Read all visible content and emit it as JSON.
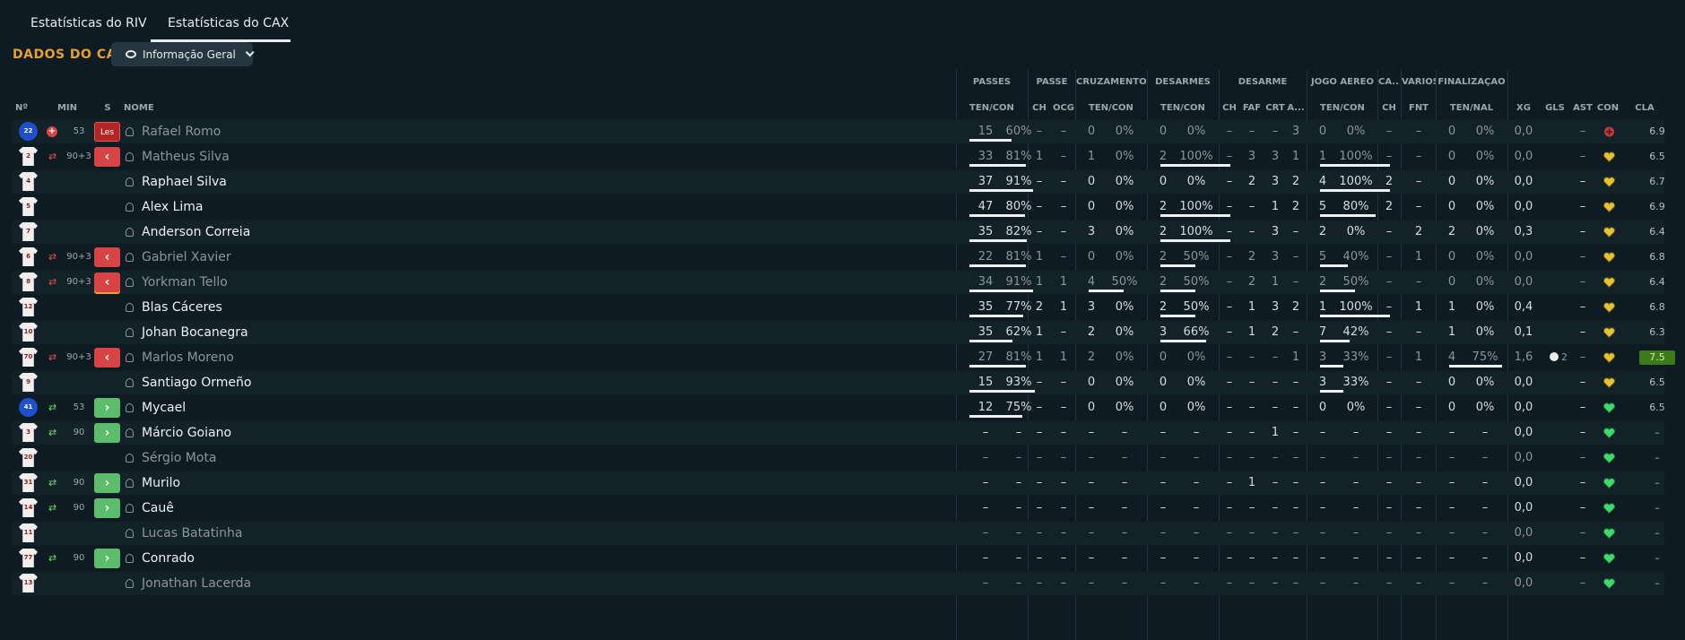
{
  "tabs": [
    {
      "label": "Estatísticas do RIV"
    },
    {
      "label": "Estatísticas do CAX"
    }
  ],
  "heading": "DADOS DO CAX",
  "dropdown": {
    "label": "Informação Geral"
  },
  "groups": {
    "passes": "PASSES",
    "passe": "PASSE",
    "cruzamentos": "CRUZAMENTOS",
    "desarmes": "DESARMES",
    "desarme": "DESARME",
    "jogo_aereo": "JOGO AÉREO",
    "ca": "CA...",
    "varios": "VÁRIOS",
    "finalizacao": "FINALIZAÇÃO"
  },
  "headers": {
    "n": "Nº",
    "min": "MIN",
    "s": "S",
    "nome": "NOME",
    "passes_tc": "TEN/CON",
    "passe_ch": "CH",
    "passe_ocg": "OCG",
    "cruz_tc": "TEN/CON",
    "des_tc": "TEN/CON",
    "d_ch": "CH",
    "d_faf": "FAF",
    "d_crt": "CRT",
    "d_a": "A...",
    "ja_tc": "TEN/CON",
    "ca_ch": "CH",
    "v_fnt": "FNT",
    "fin_tn": "TEN/NAL",
    "xg": "XG",
    "gls": "GLS",
    "ast": "AST",
    "con": "CON",
    "cla": "CLA"
  },
  "rows": [
    {
      "num": "22",
      "kit": "blue",
      "icon": "injury",
      "min": "53",
      "s": "Les",
      "sk": "les",
      "name": "Rafael Romo",
      "dim": true,
      "p1": "15",
      "p2": "60%",
      "pch": "–",
      "pocg": "–",
      "cr1": "0",
      "cr2": "0%",
      "de1": "0",
      "de2": "0%",
      "dch": "–",
      "dfaf": "–",
      "dcrt": "–",
      "da": "3",
      "ja1": "0",
      "ja2": "0%",
      "cach": "–",
      "vfnt": "–",
      "fi1": "0",
      "fi2": "0%",
      "xg": "0,0",
      "gls": "",
      "ast": "–",
      "con": "red",
      "cla": "6.9",
      "bars": {
        "p": 0.6
      }
    },
    {
      "num": "2",
      "kit": "white",
      "icon": "out",
      "min": "90+3",
      "s": "‹",
      "sk": "out",
      "name": "Matheus Silva",
      "dim": true,
      "p1": "33",
      "p2": "81%",
      "pch": "1",
      "pocg": "–",
      "cr1": "1",
      "cr2": "0%",
      "de1": "2",
      "de2": "100%",
      "dch": "–",
      "dfaf": "3",
      "dcrt": "3",
      "da": "1",
      "ja1": "1",
      "ja2": "100%",
      "cach": "–",
      "vfnt": "–",
      "fi1": "0",
      "fi2": "0%",
      "xg": "0,0",
      "gls": "",
      "ast": "–",
      "con": "yellow",
      "cla": "6.5",
      "bars": {
        "p": 0.81,
        "de": 1,
        "ja": 1
      }
    },
    {
      "num": "4",
      "kit": "white",
      "icon": "",
      "min": "",
      "s": "",
      "sk": "",
      "name": "Raphael Silva",
      "dim": false,
      "p1": "37",
      "p2": "91%",
      "pch": "–",
      "pocg": "–",
      "cr1": "0",
      "cr2": "0%",
      "de1": "0",
      "de2": "0%",
      "dch": "–",
      "dfaf": "2",
      "dcrt": "3",
      "da": "2",
      "ja1": "4",
      "ja2": "100%",
      "cach": "2",
      "vfnt": "–",
      "fi1": "0",
      "fi2": "0%",
      "xg": "0,0",
      "gls": "",
      "ast": "–",
      "con": "yellow",
      "cla": "6.7",
      "bars": {
        "p": 0.91,
        "ja": 1
      }
    },
    {
      "num": "5",
      "kit": "white",
      "icon": "",
      "min": "",
      "s": "",
      "sk": "",
      "name": "Alex Lima",
      "dim": false,
      "p1": "47",
      "p2": "80%",
      "pch": "–",
      "pocg": "–",
      "cr1": "0",
      "cr2": "0%",
      "de1": "2",
      "de2": "100%",
      "dch": "–",
      "dfaf": "–",
      "dcrt": "1",
      "da": "2",
      "ja1": "5",
      "ja2": "80%",
      "cach": "2",
      "vfnt": "–",
      "fi1": "0",
      "fi2": "0%",
      "xg": "0,0",
      "gls": "",
      "ast": "–",
      "con": "yellow",
      "cla": "6.9",
      "bars": {
        "p": 0.8,
        "de": 1,
        "ja": 0.8
      }
    },
    {
      "num": "7",
      "kit": "white",
      "icon": "",
      "min": "",
      "s": "",
      "sk": "",
      "name": "Anderson Correia",
      "dim": false,
      "p1": "35",
      "p2": "82%",
      "pch": "–",
      "pocg": "–",
      "cr1": "3",
      "cr2": "0%",
      "de1": "2",
      "de2": "100%",
      "dch": "–",
      "dfaf": "–",
      "dcrt": "3",
      "da": "–",
      "ja1": "2",
      "ja2": "0%",
      "cach": "–",
      "vfnt": "2",
      "fi1": "2",
      "fi2": "0%",
      "xg": "0,3",
      "gls": "",
      "ast": "–",
      "con": "yellow",
      "cla": "6.4",
      "bars": {
        "p": 0.82,
        "de": 1
      }
    },
    {
      "num": "6",
      "kit": "white",
      "icon": "out",
      "min": "90+3",
      "s": "‹",
      "sk": "out",
      "name": "Gabriel Xavier",
      "dim": true,
      "p1": "22",
      "p2": "81%",
      "pch": "1",
      "pocg": "–",
      "cr1": "0",
      "cr2": "0%",
      "de1": "2",
      "de2": "50%",
      "dch": "–",
      "dfaf": "2",
      "dcrt": "3",
      "da": "–",
      "ja1": "5",
      "ja2": "40%",
      "cach": "–",
      "vfnt": "1",
      "fi1": "0",
      "fi2": "0%",
      "xg": "0,0",
      "gls": "",
      "ast": "–",
      "con": "yellow",
      "cla": "6.8",
      "bars": {
        "p": 0.81,
        "de": 0.5,
        "ja": 0.4
      }
    },
    {
      "num": "8",
      "kit": "white",
      "icon": "out",
      "min": "90+3",
      "s": "‹",
      "sk": "out-sel",
      "name": "Yorkman Tello",
      "dim": true,
      "p1": "34",
      "p2": "91%",
      "pch": "1",
      "pocg": "1",
      "cr1": "4",
      "cr2": "50%",
      "de1": "2",
      "de2": "50%",
      "dch": "–",
      "dfaf": "2",
      "dcrt": "1",
      "da": "–",
      "ja1": "2",
      "ja2": "50%",
      "cach": "–",
      "vfnt": "–",
      "fi1": "0",
      "fi2": "0%",
      "xg": "0,0",
      "gls": "",
      "ast": "–",
      "con": "yellow",
      "cla": "6.4",
      "bars": {
        "p": 0.91,
        "cr": 0.5,
        "de": 0.5,
        "ja": 0.5
      }
    },
    {
      "num": "12",
      "kit": "white",
      "icon": "",
      "min": "",
      "s": "",
      "sk": "",
      "name": "Blas Cáceres",
      "dim": false,
      "p1": "35",
      "p2": "77%",
      "pch": "2",
      "pocg": "1",
      "cr1": "3",
      "cr2": "0%",
      "de1": "2",
      "de2": "50%",
      "dch": "–",
      "dfaf": "1",
      "dcrt": "3",
      "da": "2",
      "ja1": "1",
      "ja2": "100%",
      "cach": "–",
      "vfnt": "1",
      "fi1": "1",
      "fi2": "0%",
      "xg": "0,4",
      "gls": "",
      "ast": "–",
      "con": "yellow",
      "cla": "6.8",
      "bars": {
        "p": 0.77,
        "de": 0.5,
        "ja": 1
      }
    },
    {
      "num": "10",
      "kit": "white",
      "icon": "",
      "min": "",
      "s": "",
      "sk": "",
      "name": "Johan Bocanegra",
      "dim": false,
      "p1": "35",
      "p2": "62%",
      "pch": "1",
      "pocg": "–",
      "cr1": "2",
      "cr2": "0%",
      "de1": "3",
      "de2": "66%",
      "dch": "–",
      "dfaf": "1",
      "dcrt": "2",
      "da": "–",
      "ja1": "7",
      "ja2": "42%",
      "cach": "–",
      "vfnt": "–",
      "fi1": "1",
      "fi2": "0%",
      "xg": "0,1",
      "gls": "",
      "ast": "–",
      "con": "yellow",
      "cla": "6.3",
      "bars": {
        "p": 0.62,
        "de": 0.66,
        "ja": 0.42
      }
    },
    {
      "num": "70",
      "kit": "white",
      "icon": "out",
      "min": "90+3",
      "s": "‹",
      "sk": "out",
      "name": "Marlos Moreno",
      "dim": true,
      "p1": "27",
      "p2": "81%",
      "pch": "1",
      "pocg": "1",
      "cr1": "2",
      "cr2": "0%",
      "de1": "0",
      "de2": "0%",
      "dch": "–",
      "dfaf": "–",
      "dcrt": "–",
      "da": "1",
      "ja1": "3",
      "ja2": "33%",
      "cach": "–",
      "vfnt": "1",
      "fi1": "4",
      "fi2": "75%",
      "xg": "1,6",
      "gls": "2",
      "ast": "–",
      "con": "yellow",
      "cla": "7.5",
      "bars": {
        "p": 0.81,
        "ja": 0.33,
        "fi": 0.75
      }
    },
    {
      "num": "9",
      "kit": "white",
      "icon": "",
      "min": "",
      "s": "",
      "sk": "",
      "name": "Santiago Ormeño",
      "dim": false,
      "p1": "15",
      "p2": "93%",
      "pch": "–",
      "pocg": "–",
      "cr1": "0",
      "cr2": "0%",
      "de1": "0",
      "de2": "0%",
      "dch": "–",
      "dfaf": "–",
      "dcrt": "–",
      "da": "–",
      "ja1": "3",
      "ja2": "33%",
      "cach": "–",
      "vfnt": "–",
      "fi1": "0",
      "fi2": "0%",
      "xg": "0,0",
      "gls": "",
      "ast": "–",
      "con": "yellow",
      "cla": "6.5",
      "bars": {
        "p": 0.93,
        "ja": 0.33
      }
    },
    {
      "num": "41",
      "kit": "blue",
      "icon": "in",
      "min": "53",
      "s": "›",
      "sk": "in",
      "name": "Mycael",
      "dim": false,
      "p1": "12",
      "p2": "75%",
      "pch": "–",
      "pocg": "–",
      "cr1": "0",
      "cr2": "0%",
      "de1": "0",
      "de2": "0%",
      "dch": "–",
      "dfaf": "–",
      "dcrt": "–",
      "da": "–",
      "ja1": "0",
      "ja2": "0%",
      "cach": "–",
      "vfnt": "–",
      "fi1": "0",
      "fi2": "0%",
      "xg": "0,0",
      "gls": "",
      "ast": "–",
      "con": "green",
      "cla": "6.5",
      "bars": {
        "p": 0.75
      }
    },
    {
      "num": "3",
      "kit": "white",
      "icon": "in",
      "min": "90",
      "s": "›",
      "sk": "in",
      "name": "Márcio Goiano",
      "dim": false,
      "p1": "–",
      "p2": "–",
      "pch": "–",
      "pocg": "–",
      "cr1": "–",
      "cr2": "–",
      "de1": "–",
      "de2": "–",
      "dch": "–",
      "dfaf": "–",
      "dcrt": "1",
      "da": "–",
      "ja1": "–",
      "ja2": "–",
      "cach": "–",
      "vfnt": "–",
      "fi1": "–",
      "fi2": "–",
      "xg": "0,0",
      "gls": "",
      "ast": "–",
      "con": "green",
      "cla": "–",
      "bars": {}
    },
    {
      "num": "20",
      "kit": "white",
      "icon": "",
      "min": "",
      "s": "",
      "sk": "",
      "name": "Sérgio Mota",
      "dim": true,
      "p1": "–",
      "p2": "–",
      "pch": "–",
      "pocg": "–",
      "cr1": "–",
      "cr2": "–",
      "de1": "–",
      "de2": "–",
      "dch": "–",
      "dfaf": "–",
      "dcrt": "–",
      "da": "–",
      "ja1": "–",
      "ja2": "–",
      "cach": "–",
      "vfnt": "–",
      "fi1": "–",
      "fi2": "–",
      "xg": "0,0",
      "gls": "",
      "ast": "–",
      "con": "green",
      "cla": "–",
      "bars": {}
    },
    {
      "num": "31",
      "kit": "white",
      "icon": "in",
      "min": "90",
      "s": "›",
      "sk": "in",
      "name": "Murilo",
      "dim": false,
      "p1": "–",
      "p2": "–",
      "pch": "–",
      "pocg": "–",
      "cr1": "–",
      "cr2": "–",
      "de1": "–",
      "de2": "–",
      "dch": "–",
      "dfaf": "1",
      "dcrt": "–",
      "da": "–",
      "ja1": "–",
      "ja2": "–",
      "cach": "–",
      "vfnt": "–",
      "fi1": "–",
      "fi2": "–",
      "xg": "0,0",
      "gls": "",
      "ast": "–",
      "con": "green",
      "cla": "–",
      "bars": {}
    },
    {
      "num": "14",
      "kit": "white",
      "icon": "in",
      "min": "90",
      "s": "›",
      "sk": "in",
      "name": "Cauê",
      "dim": false,
      "p1": "–",
      "p2": "–",
      "pch": "–",
      "pocg": "–",
      "cr1": "–",
      "cr2": "–",
      "de1": "–",
      "de2": "–",
      "dch": "–",
      "dfaf": "–",
      "dcrt": "–",
      "da": "–",
      "ja1": "–",
      "ja2": "–",
      "cach": "–",
      "vfnt": "–",
      "fi1": "–",
      "fi2": "–",
      "xg": "0,0",
      "gls": "",
      "ast": "–",
      "con": "green",
      "cla": "–",
      "bars": {}
    },
    {
      "num": "11",
      "kit": "white",
      "icon": "",
      "min": "",
      "s": "",
      "sk": "",
      "name": "Lucas Batatinha",
      "dim": true,
      "p1": "–",
      "p2": "–",
      "pch": "–",
      "pocg": "–",
      "cr1": "–",
      "cr2": "–",
      "de1": "–",
      "de2": "–",
      "dch": "–",
      "dfaf": "–",
      "dcrt": "–",
      "da": "–",
      "ja1": "–",
      "ja2": "–",
      "cach": "–",
      "vfnt": "–",
      "fi1": "–",
      "fi2": "–",
      "xg": "0,0",
      "gls": "",
      "ast": "–",
      "con": "green",
      "cla": "–",
      "bars": {}
    },
    {
      "num": "77",
      "kit": "white",
      "icon": "in",
      "min": "90",
      "s": "›",
      "sk": "in",
      "name": "Conrado",
      "dim": false,
      "p1": "–",
      "p2": "–",
      "pch": "–",
      "pocg": "–",
      "cr1": "–",
      "cr2": "–",
      "de1": "–",
      "de2": "–",
      "dch": "–",
      "dfaf": "–",
      "dcrt": "–",
      "da": "–",
      "ja1": "–",
      "ja2": "–",
      "cach": "–",
      "vfnt": "–",
      "fi1": "–",
      "fi2": "–",
      "xg": "0,0",
      "gls": "",
      "ast": "–",
      "con": "green",
      "cla": "–",
      "bars": {}
    },
    {
      "num": "13",
      "kit": "white",
      "icon": "",
      "min": "",
      "s": "",
      "sk": "",
      "name": "Jonathan Lacerda",
      "dim": true,
      "p1": "–",
      "p2": "–",
      "pch": "–",
      "pocg": "–",
      "cr1": "–",
      "cr2": "–",
      "de1": "–",
      "de2": "–",
      "dch": "–",
      "dfaf": "–",
      "dcrt": "–",
      "da": "–",
      "ja1": "–",
      "ja2": "–",
      "cach": "–",
      "vfnt": "–",
      "fi1": "–",
      "fi2": "–",
      "xg": "0,0",
      "gls": "",
      "ast": "–",
      "con": "green",
      "cla": "–",
      "bars": {}
    }
  ]
}
